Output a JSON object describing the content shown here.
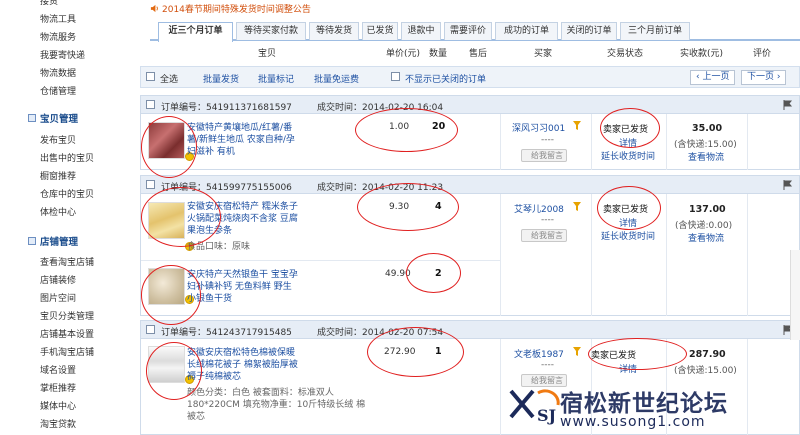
{
  "sidebar": {
    "top_cut": "接货",
    "group1": [
      "物流工具",
      "物流服务",
      "我要寄快递",
      "物流数据",
      "仓储管理"
    ],
    "section_goods": "宝贝管理",
    "group2": [
      "发布宝贝",
      "出售中的宝贝",
      "橱窗推荐",
      "仓库中的宝贝",
      "体检中心"
    ],
    "section_shop": "店铺管理",
    "group3": [
      "查看淘宝店铺",
      "店铺装修",
      "图片空间",
      "宝贝分类管理",
      "店铺基本设置",
      "手机淘宝店铺",
      "域名设置",
      "掌柜推荐",
      "媒体中心",
      "淘宝贷款"
    ]
  },
  "notice": "2014春节期间特殊发货时间调整公告",
  "tabs": [
    "近三个月订单",
    "等待买家付款",
    "等待发货",
    "已发货",
    "退款中",
    "需要评价",
    "成功的订单",
    "关闭的订单",
    "三个月前订单"
  ],
  "columns": {
    "item": "宝贝",
    "unit_price": "单价(元)",
    "qty": "数量",
    "after_sale": "售后",
    "buyer": "买家",
    "status": "交易状态",
    "paid": "实收款(元)",
    "review": "评价"
  },
  "toolbar": {
    "select_all": "全选",
    "batch_ship": "批量发货",
    "batch_mark": "批量标记",
    "batch_free_review": "批量免运费",
    "hide_closed": "不显示已关闭的订单",
    "prev": "上一页",
    "next": "下一页"
  },
  "orders": [
    {
      "no_label": "订单编号：541911371681597",
      "time_label": "成交时间：2014-02-20 16:04",
      "items": [
        {
          "title": "安徽特产黄壤地瓜/红薯/番薯/新鲜生地瓜 农家自种/孕妇滋补 有机",
          "sku": "",
          "price": "1.00",
          "qty": "20"
        }
      ],
      "buyer": "深风习习001",
      "buyer_sub": "----",
      "msg": "给我留言",
      "status": "卖家已发货",
      "detail": "详情",
      "extend": "延长收货时间",
      "amount": "35.00",
      "shipping": "(含快递:15.00)",
      "logistics": "查看物流"
    },
    {
      "no_label": "订单编号：541599775155006",
      "time_label": "成交时间：2014-02-20 11:23",
      "items": [
        {
          "title": "安徽安庆宿松特产 糯米条子火锅配菜炖烧肉不含浆 豆腐果泡生参条",
          "sku": "食品口味：原味",
          "price": "9.30",
          "qty": "4"
        },
        {
          "title": "安庆特产天然银鱼干 宝宝孕妇补碘补钙 无鱼料鲜 野生小银鱼干货",
          "sku": "",
          "price": "49.90",
          "qty": "2"
        }
      ],
      "buyer": "艾琴儿2008",
      "buyer_sub": "----",
      "msg": "给我留言",
      "status": "卖家已发货",
      "detail": "详情",
      "extend": "延长收货时间",
      "amount": "137.00",
      "shipping": "(含快递:0.00)",
      "logistics": "查看物流"
    },
    {
      "no_label": "订单编号：541243717915485",
      "time_label": "成交时间：2014-02-20 07:54",
      "items": [
        {
          "title": "安徽安庆宿松特色棉被保暖长绒棉花被子 棉絮被胎厚被褥子纯棉被芯",
          "sku": "颜色分类：白色   被套面料：标准双人 180*220CM   填充物净重：10斤特级长绒 棉被芯",
          "price": "272.90",
          "qty": "1"
        }
      ],
      "buyer": "文老板1987",
      "buyer_sub": "----",
      "msg": "给我留言",
      "status": "卖家已发货",
      "detail": "详情",
      "extend": "",
      "amount": "287.90",
      "shipping": "(含快递:15.00)",
      "logistics": ""
    }
  ],
  "watermark": {
    "name": "宿松新世纪论坛",
    "url": "www.susong1.com",
    "logo": "XSJ-logo"
  },
  "colors": {
    "link": "#1e50a2",
    "accent_red": "#e02020",
    "header_bg": "#e6edf6",
    "notice": "#d2500e"
  }
}
